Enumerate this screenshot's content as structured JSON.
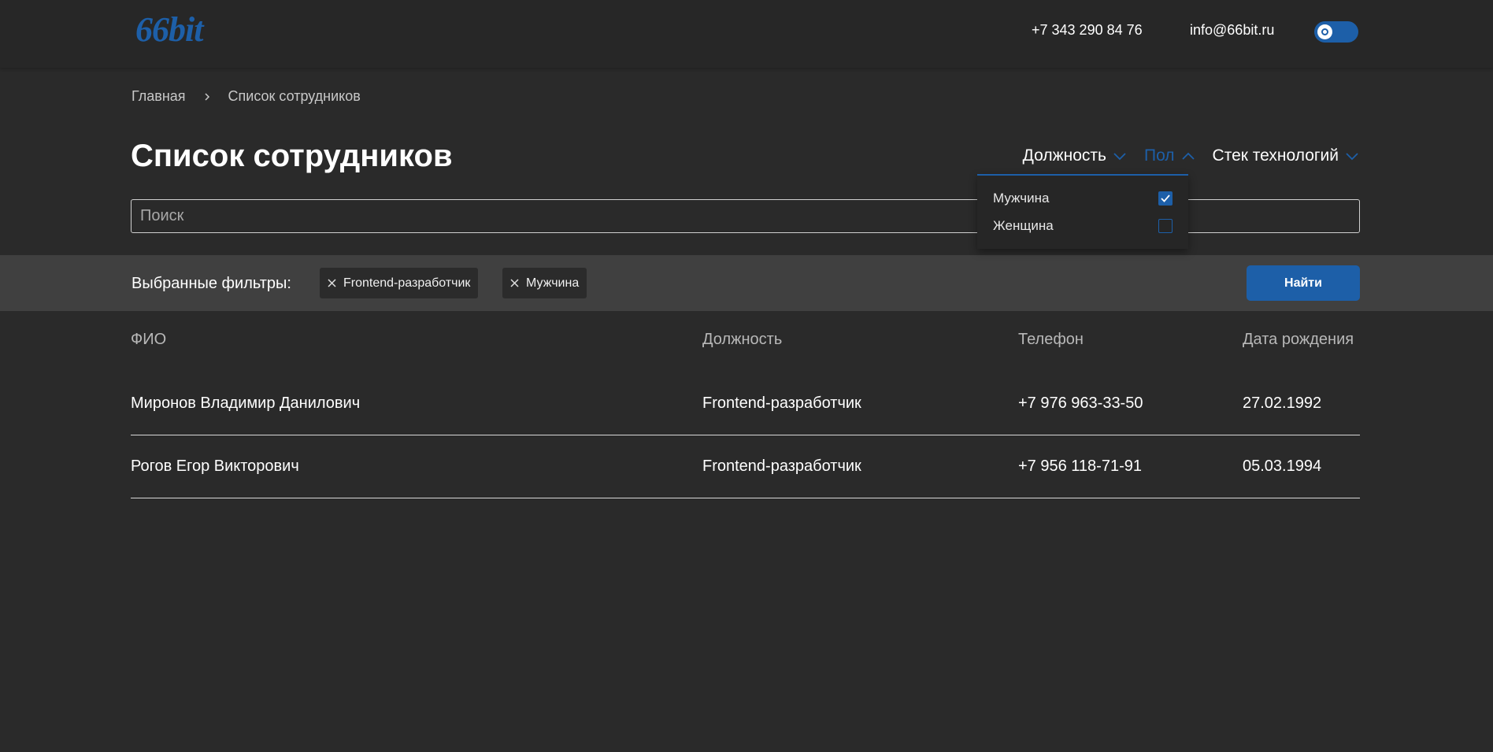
{
  "header": {
    "logo": "66bit",
    "phone": "+7 343 290 84 76",
    "email": "info@66bit.ru",
    "theme_toggle": "on"
  },
  "breadcrumb": {
    "home": "Главная",
    "current": "Список сотрудников"
  },
  "page": {
    "title": "Список сотрудников"
  },
  "filters": [
    {
      "label": "Должность",
      "state": "collapsed"
    },
    {
      "label": "Пол",
      "state": "expanded"
    },
    {
      "label": "Стек технологий",
      "state": "collapsed"
    }
  ],
  "gender_dropdown": {
    "options": [
      {
        "label": "Мужчина",
        "checked": true
      },
      {
        "label": "Женщина",
        "checked": false
      }
    ]
  },
  "search": {
    "placeholder": "Поиск",
    "value": ""
  },
  "selected_filters": {
    "label": "Выбранные фильтры:",
    "chips": [
      "Frontend-разработчик",
      "Мужчина"
    ],
    "find_label": "Найти"
  },
  "table": {
    "headers": [
      "ФИО",
      "Должность",
      "Телефон",
      "Дата рождения"
    ],
    "rows": [
      {
        "name": "Миронов Владимир Данилович",
        "position": "Frontend-разработчик",
        "phone": "+7 976 963-33-50",
        "birth_date": "27.02.1992"
      },
      {
        "name": "Рогов Егор Викторович",
        "position": "Frontend-разработчик",
        "phone": "+7 956 118-71-91",
        "birth_date": "05.03.1994"
      }
    ]
  },
  "colors": {
    "accent": "#1d5fa8",
    "background": "#2a2a2a",
    "filter_bar": "#404040"
  }
}
